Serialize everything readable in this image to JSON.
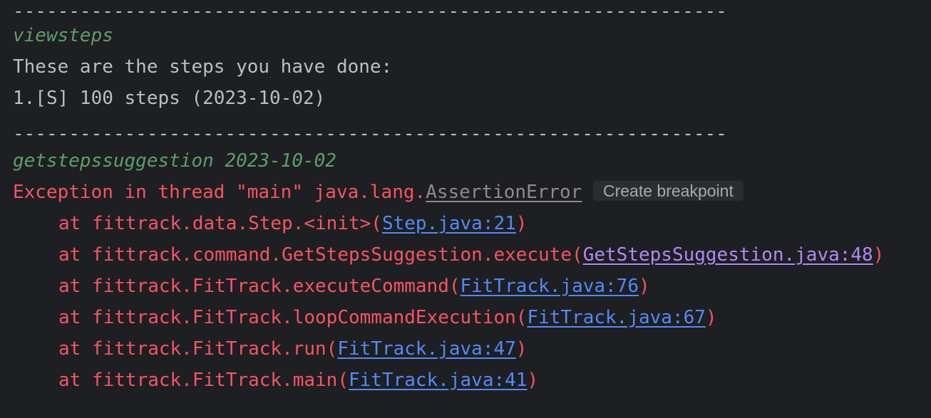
{
  "console": {
    "divider_1": "----------------------------------------------------------------",
    "command_1": "viewsteps",
    "output_1": "These are the steps you have done:",
    "output_2": "1.[S] 100 steps (2023-10-02)",
    "divider_2": "----------------------------------------------------------------",
    "command_2": "getstepssuggestion 2023-10-02",
    "exception": {
      "prefix": "Exception in thread \"main\" java.lang.",
      "class_name": "AssertionError",
      "breakpoint_label": "Create breakpoint"
    },
    "stack": [
      {
        "prefix": "at fittrack.data.Step.<init>(",
        "link": "Step.java:21",
        "suffix": ")"
      },
      {
        "prefix": "at fittrack.command.GetStepsSuggestion.execute(",
        "link": "GetStepsSuggestion.java:48",
        "suffix": ")"
      },
      {
        "prefix": "at fittrack.FitTrack.executeCommand(",
        "link": "FitTrack.java:76",
        "suffix": ")"
      },
      {
        "prefix": "at fittrack.FitTrack.loopCommandExecution(",
        "link": "FitTrack.java:67",
        "suffix": ")"
      },
      {
        "prefix": "at fittrack.FitTrack.run(",
        "link": "FitTrack.java:47",
        "suffix": ")"
      },
      {
        "prefix": "at fittrack.FitTrack.main(",
        "link": "FitTrack.java:41",
        "suffix": ")"
      }
    ]
  },
  "colors": {
    "background": "#1e1f22",
    "text": "#bcbec4",
    "command": "#5f9e6a",
    "error": "#f75464",
    "link": "#548af7",
    "visited_link": "#b189f5"
  }
}
